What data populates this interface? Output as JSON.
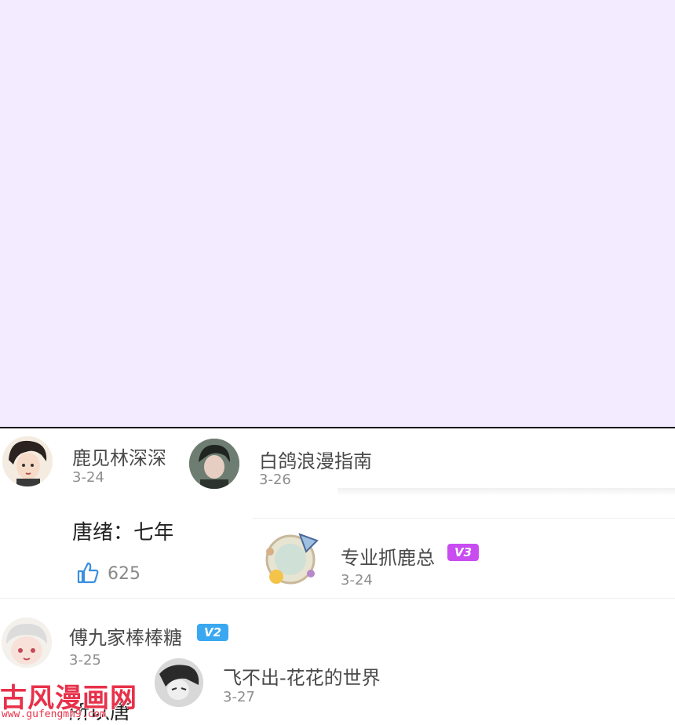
{
  "comments": [
    {
      "user": "鹿见林深深",
      "date": "3-24",
      "text": "唐绪：七年",
      "likes": "625"
    },
    {
      "user": "白鸽浪漫指南",
      "date": "3-26"
    },
    {
      "user": "专业抓鹿总",
      "date": "3-24",
      "badge": "V3",
      "badge_color": "#c94cf0"
    },
    {
      "user": "傅九家棒棒糖",
      "date": "3-25",
      "badge": "V2",
      "badge_color": "#3aa8f0",
      "text": "所以唐"
    },
    {
      "user": "飞不出-花花的世界",
      "date": "3-27"
    }
  ],
  "watermark": {
    "title": "古风漫画网",
    "url": "www.gufengmh9.com"
  },
  "colors": {
    "top_panel": "#f3ebff",
    "accent_like": "#3a8fe0"
  }
}
